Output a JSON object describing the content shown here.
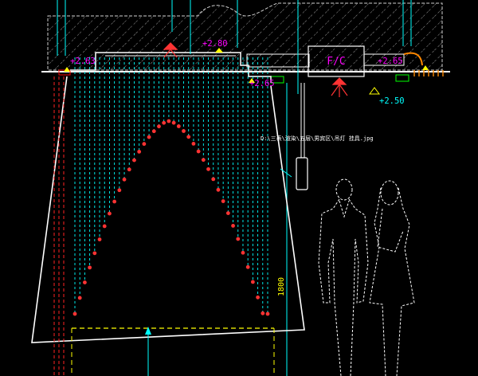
{
  "drawing": {
    "background": "#000000",
    "colors": {
      "outline": "#ffffff",
      "dim": "#00ffff",
      "tag": "#ff00ff",
      "bead": "#ff3333",
      "bead_line": "#ff0000",
      "green": "#00ff00",
      "yellow": "#ffff00",
      "orange": "#ff8800",
      "gray": "#9a9a9a"
    },
    "elevations": {
      "e_top_center": "+2.80",
      "e_left": "+2.63",
      "e_mid": "+2.65",
      "e_right": "+2.65",
      "e_right_low": "+2.50"
    },
    "labels": {
      "fc": "F/C",
      "vertical_dim": "1800",
      "image_path": "D:\\三表\\渲染\\五层\\男宾区\\吊灯 挂具.jpg"
    },
    "icons": {
      "downlight": "downlight-icon",
      "level_marker": "elevation-marker-icon",
      "figures": "people-silhouette-icon"
    }
  }
}
